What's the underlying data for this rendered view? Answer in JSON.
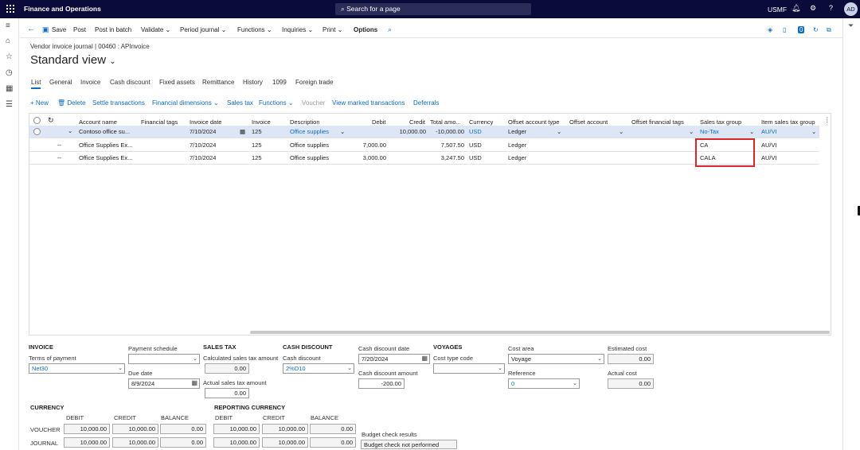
{
  "app": {
    "title": "Finance and Operations",
    "search_placeholder": "Search for a page",
    "company": "USMF",
    "user_initials": "AD"
  },
  "actions": {
    "save": "Save",
    "post": "Post",
    "post_in_batch": "Post in batch",
    "validate": "Validate",
    "period_journal": "Period journal",
    "functions": "Functions",
    "inquiries": "Inquiries",
    "print": "Print",
    "options": "Options"
  },
  "page": {
    "caption": "Vendor invoice journal  |  00460 : APInvoice",
    "title": "Standard view"
  },
  "tabs": [
    "List",
    "General",
    "Invoice",
    "Cash discount",
    "Fixed assets",
    "Remittance",
    "History",
    "1099",
    "Foreign trade"
  ],
  "grid_toolbar": {
    "new": "New",
    "delete": "Delete",
    "settle": "Settle transactions",
    "financial_dimensions": "Financial dimensions",
    "sales_tax": "Sales tax",
    "functions": "Functions",
    "voucher": "Voucher",
    "view_marked": "View marked transactions",
    "deferrals": "Deferrals"
  },
  "grid": {
    "columns": [
      "Account name",
      "Financial tags",
      "Invoice date",
      "Invoice",
      "Description",
      "Debit",
      "Credit",
      "Total amo...",
      "Currency",
      "Offset account type",
      "Offset account",
      "Offset financial tags",
      "Sales tax group",
      "Item sales tax group"
    ],
    "rows": [
      {
        "marker": "",
        "account_name": "Contoso office su...",
        "financial_tags": "",
        "invoice_date": "7/10/2024",
        "invoice": "125",
        "description": "Office supplies",
        "debit": "",
        "credit": "10,000.00",
        "total": "-10,000.00",
        "currency": "USD",
        "offset_type": "Ledger",
        "offset_account": "",
        "offset_tags": "",
        "sales_tax_group": "No-Tax",
        "item_sales_tax_group": "AU/VI"
      },
      {
        "marker": "--",
        "account_name": "Office Supplies Ex...",
        "financial_tags": "",
        "invoice_date": "7/10/2024",
        "invoice": "125",
        "description": "Office supplies",
        "debit": "7,000.00",
        "credit": "",
        "total": "7,507.50",
        "currency": "USD",
        "offset_type": "Ledger",
        "offset_account": "",
        "offset_tags": "",
        "sales_tax_group": "CA",
        "item_sales_tax_group": "AU/VI"
      },
      {
        "marker": "--",
        "account_name": "Office Supplies Ex...",
        "financial_tags": "",
        "invoice_date": "7/10/2024",
        "invoice": "125",
        "description": "Office supplies",
        "debit": "3,000.00",
        "credit": "",
        "total": "3,247.50",
        "currency": "USD",
        "offset_type": "Ledger",
        "offset_account": "",
        "offset_tags": "",
        "sales_tax_group": "CALA",
        "item_sales_tax_group": "AU/VI"
      }
    ]
  },
  "invoice": {
    "section": "INVOICE",
    "terms_label": "Terms of payment",
    "terms_value": "Net30",
    "schedule_label": "Payment schedule",
    "schedule_value": "",
    "due_label": "Due date",
    "due_value": "8/9/2024"
  },
  "sales_tax": {
    "section": "SALES TAX",
    "calc_label": "Calculated sales tax amount",
    "calc_value": "0.00",
    "actual_label": "Actual sales tax amount",
    "actual_value": "0.00"
  },
  "cash_discount": {
    "section": "CASH DISCOUNT",
    "label": "Cash discount",
    "value": "2%D10",
    "date_label": "Cash discount date",
    "date_value": "7/20/2024",
    "amount_label": "Cash discount amount",
    "amount_value": "-200.00"
  },
  "voyages": {
    "section": "VOYAGES",
    "cost_type_label": "Cost type code",
    "cost_type_value": "",
    "cost_area_label": "Cost area",
    "cost_area_value": "Voyage",
    "reference_label": "Reference",
    "reference_value": "0",
    "estimated_label": "Estimated cost",
    "estimated_value": "0.00",
    "actual_label": "Actual cost",
    "actual_value": "0.00"
  },
  "currency": {
    "section": "CURRENCY",
    "reporting_section": "REPORTING CURRENCY",
    "col_debit": "DEBIT",
    "col_credit": "CREDIT",
    "col_balance": "BALANCE",
    "voucher_label": "VOUCHER",
    "journal_label": "JOURNAL",
    "voucher": {
      "debit": "10,000.00",
      "credit": "10,000.00",
      "balance": "0.00"
    },
    "journal": {
      "debit": "10,000.00",
      "credit": "10,000.00",
      "balance": "0.00"
    },
    "rep_voucher": {
      "debit": "10,000.00",
      "credit": "10,000.00",
      "balance": "0.00"
    },
    "rep_journal": {
      "debit": "10,000.00",
      "credit": "10,000.00",
      "balance": "0.00"
    }
  },
  "budget": {
    "label": "Budget check results",
    "value": "Budget check not performed"
  },
  "colors": {
    "nav": "#0b0b3b",
    "accent": "#0f6cbd",
    "highlight": "#d9272e",
    "selected_row": "#dde6f6"
  }
}
